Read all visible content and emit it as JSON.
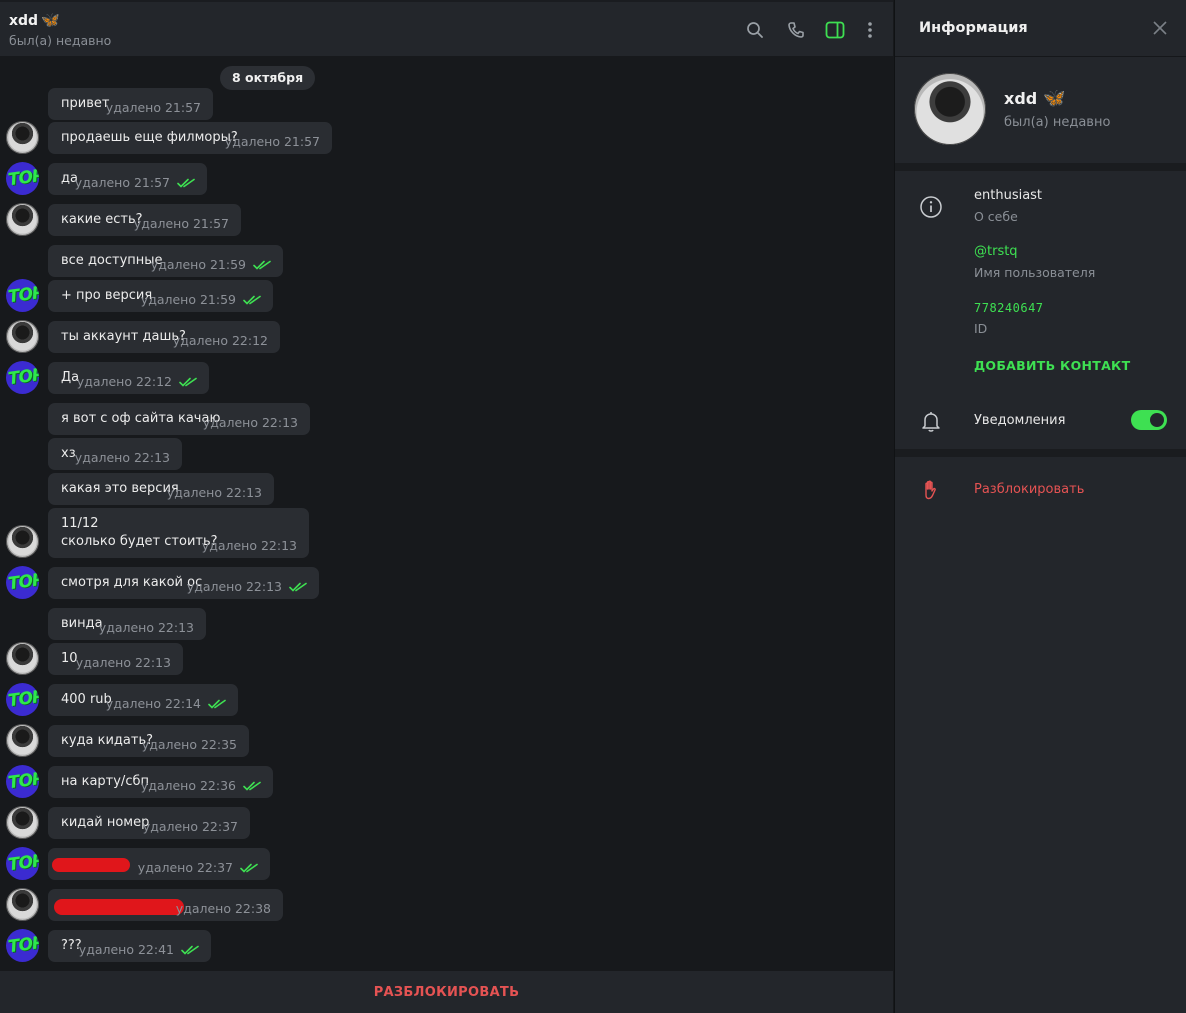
{
  "header": {
    "name": "xdd",
    "name_emoji": "🦋",
    "status": "был(а) недавно",
    "icons": [
      "search-icon",
      "phone-icon",
      "sidebar-toggle-icon",
      "more-vert-icon"
    ]
  },
  "date_pill": "8 октября",
  "messages": [
    {
      "text": "привет",
      "meta": "удалено 21:57",
      "from": "them",
      "check": false
    },
    {
      "text": "продаешь еще филморы?",
      "meta": "удалено 21:57",
      "from": "them",
      "check": false
    },
    {
      "text": "да",
      "meta": "удалено 21:57",
      "from": "me",
      "check": true
    },
    {
      "text": "какие есть?",
      "meta": "удалено 21:57",
      "from": "them",
      "check": false
    },
    {
      "text": "все доступные",
      "meta": "удалено 21:59",
      "from": "me",
      "check": true
    },
    {
      "text": "+ про версия",
      "meta": "удалено 21:59",
      "from": "me",
      "check": true
    },
    {
      "text": "ты аккаунт дашь?",
      "meta": "удалено 22:12",
      "from": "them",
      "check": false
    },
    {
      "text": "Да",
      "meta": "удалено 22:12",
      "from": "me",
      "check": true
    },
    {
      "text": "я вот с оф сайта качаю",
      "meta": "удалено 22:13",
      "from": "them",
      "check": false
    },
    {
      "text": "хз",
      "meta": "удалено 22:13",
      "from": "them",
      "check": false
    },
    {
      "text": "какая это версия",
      "meta": "удалено 22:13",
      "from": "them",
      "check": false
    },
    {
      "text": "11/12\nсколько будет стоить?",
      "meta": "удалено 22:13",
      "from": "them",
      "check": false
    },
    {
      "text": "смотря для какой ос",
      "meta": "удалено 22:13",
      "from": "me",
      "check": true
    },
    {
      "text": "винда",
      "meta": "удалено 22:13",
      "from": "them",
      "check": false
    },
    {
      "text": "10",
      "meta": "удалено 22:13",
      "from": "them",
      "check": false
    },
    {
      "text": "400 rub",
      "meta": "удалено 22:14",
      "from": "me",
      "check": true
    },
    {
      "text": "куда кидать?",
      "meta": "удалено 22:35",
      "from": "them",
      "check": false
    },
    {
      "text": "на карту/сбп",
      "meta": "удалено 22:36",
      "from": "me",
      "check": true
    },
    {
      "text": "кидай номер",
      "meta": "удалено 22:37",
      "from": "them",
      "check": false
    },
    {
      "text": "",
      "meta": "удалено 22:37",
      "from": "me",
      "check": true,
      "redacted": true
    },
    {
      "text": "",
      "meta": "удалено 22:38",
      "from": "them",
      "check": false,
      "redacted": true
    },
    {
      "text": "???",
      "meta": "удалено 22:41",
      "from": "me",
      "check": true
    }
  ],
  "avatar_top_label": "TOP",
  "unblock_bar_label": "РАЗБЛОКИРОВАТЬ",
  "info_panel": {
    "title": "Информация",
    "profile_name": "xdd",
    "profile_emoji": "🦋",
    "profile_status": "был(а) недавно",
    "bio_value": "enthusiast",
    "bio_label": "О себе",
    "username_value": "@trstq",
    "username_label": "Имя пользователя",
    "id_value": "778240647",
    "id_label": "ID",
    "add_contact": "ДОБАВИТЬ КОНТАКТ",
    "notifications_label": "Уведомления",
    "notifications_on": true,
    "unblock_label": "Разблокировать"
  },
  "colors": {
    "accent_green": "#3ee052",
    "danger_red": "#e55353",
    "bubble_bg": "#2a2d32",
    "chat_bg": "#17191c",
    "panel_bg": "#23262b"
  }
}
